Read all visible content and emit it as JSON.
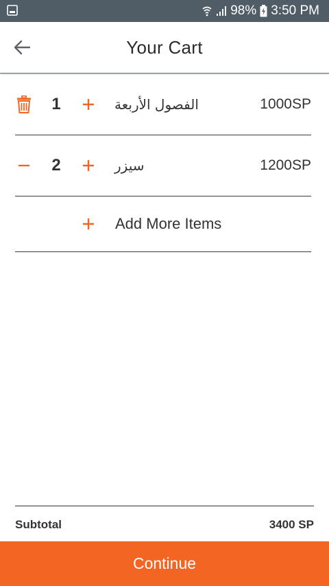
{
  "status_bar": {
    "battery": "98%",
    "time": "3:50 PM"
  },
  "header": {
    "title": "Your Cart"
  },
  "cart": {
    "items": [
      {
        "quantity": "1",
        "name": "الفصول الأربعة",
        "price": "1000SP"
      },
      {
        "quantity": "2",
        "name": "سيزر",
        "price": "1200SP"
      }
    ],
    "add_more_label": "Add More Items"
  },
  "summary": {
    "subtotal_label": "Subtotal",
    "subtotal_value": "3400 SP"
  },
  "footer": {
    "continue_label": "Continue"
  },
  "colors": {
    "accent": "#f26522",
    "status_bar": "#505d66"
  },
  "icons": {
    "back": "arrow-left-icon",
    "delete": "trash-icon",
    "decrease": "minus-icon",
    "increase": "plus-icon"
  }
}
